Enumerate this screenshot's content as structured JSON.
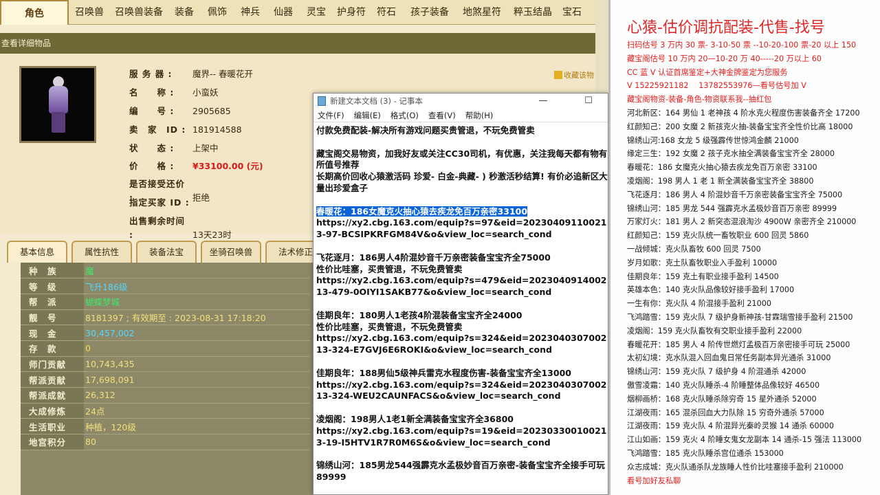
{
  "game": {
    "tabs": [
      "角色",
      "召唤兽",
      "召唤兽装备",
      "装备",
      "佩饰",
      "神兵",
      "仙器",
      "灵宝",
      "护身符",
      "符石",
      "孩子装备",
      "地煞星符",
      "粹玉结晶",
      "宝石"
    ],
    "window_title": "查看详细物品",
    "favorite_label": "收藏该物",
    "info": {
      "server_label": "服 务 器 :",
      "server_value": "魔界-- 春暖花开",
      "name_label": "名　　称 :",
      "name_value": "小蛮妖",
      "id_label": "编　　号 :",
      "id_value": "2905685",
      "seller_label": "卖　家　ID :",
      "seller_value": "181914588",
      "status_label": "状　　态 :",
      "status_value": "上架中",
      "price_label": "价　　格 :",
      "price_value": "¥33100.00 (元)",
      "bargain_label": "是否接受还价 :",
      "bargain_value": "拒绝",
      "buyer_label": "指定买家 ID :",
      "buyer_value": "",
      "remain_label": "出售剩余时间 :",
      "remain_value": "13天23时"
    },
    "subtabs": [
      "基本信息",
      "属性抗性",
      "装备法宝",
      "坐骑召唤兽",
      "法术修正"
    ],
    "stats": [
      {
        "k": "种　族",
        "v": "魔"
      },
      {
        "k": "等　级",
        "v": "飞升186级"
      },
      {
        "k": "帮　派",
        "v": "蝴蝶梦城"
      },
      {
        "k": "靓　号",
        "v": "8181397 ;  有效期至 :  2023-08-31 17:18:20"
      },
      {
        "k": "现　金",
        "v": "30,457,002"
      },
      {
        "k": "存　款",
        "v": "0"
      },
      {
        "k": "师门贡献",
        "v": "10,743,435"
      },
      {
        "k": "帮派贡献",
        "v": "17,698,091"
      },
      {
        "k": "帮派成就",
        "v": "26,312"
      },
      {
        "k": "大成修炼",
        "v": "24点"
      },
      {
        "k": "生活职业",
        "v": "种植，120级"
      },
      {
        "k": "地宫积分",
        "v": "80"
      }
    ]
  },
  "notepad": {
    "title": "新建文本文档 (3) - 记事本",
    "menu": [
      "文件(F)",
      "编辑(E)",
      "格式(O)",
      "查看(V)",
      "帮助(H)"
    ],
    "paragraphs": [
      "付款免费配装-解决所有游戏问题买贵管退，不玩免费管卖",
      "藏宝阁交易物资，加我好友或关注CC30司机，有优惠，关注我每天都有物有所值号推荐\n长期高价回收心猿激活码 珍爱- 白金-典藏- ) 秒激活秒结算! 有价必追新区大量出珍爱盒子",
      "__SEL__https://xy2.cbg.163.com/equip?s=97&eid=202304091100213-97-BCSIPKRFGM84V&o&view_loc=search_cond",
      "飞花逐月：186男人4阶混妙音千万亲密装备宝宝齐全75000\n性价比哇塞，买贵管退，不玩免费管卖\nhttps://xy2.cbg.163.com/equip?s=479&eid=202304091400213-479-0OIYI1SAKB77&o&view_loc=search_cond",
      "佳期良年：180男人1老孩4阶混装备宝宝齐全24000\n性价比哇塞，买贵管退，不玩免费管卖\nhttps://xy2.cbg.163.com/equip?s=324&eid=202304030700213-324-E7GVJ6E6ROKI&o&view_loc=search_cond",
      "佳期良年：188男仙5级神兵雷克水程度伤害-装备宝宝齐全13000\nhttps://xy2.cbg.163.com/equip?s=324&eid=202304030700213-324-WEU2CAUNFACS&o&view_loc=search_cond",
      "凌烟阁：198男人1老1新全满装备宝宝齐全36800\nhttps://xy2.cbg.163.com/equip?s=19&eid=202303300100213-19-I5HTV1R7R0M6S&o&view_loc=search_cond",
      "锦绣山河：185男龙544强霹克水孟极妙音百万亲密-装备宝宝齐全接手可玩89999"
    ],
    "selected": "春暖花：186女魔克火抽心猿去疾龙免百万亲密33100"
  },
  "promo": {
    "title": "心猿-估价调抗配装-代售-找号",
    "red_lines": [
      "扫码估号 3 万内 30 票- 3-10-50 票 --10-20-100 票-20 以上 150",
      "藏宝阁估号 10 万内 20—10-20 万 40-----20 万以上 60",
      "CC 蓝 V 认证首席鉴定+大神金牌鉴定为您服务",
      "V 15225921182　  13782553976—看号估号加 V",
      "藏宝阁物资-装备-角色-物资联系我--抽红包"
    ],
    "black_lines": [
      "河北新区：164 男仙 1 老神孩 4 阶水克火程度伤害装备齐全 17200",
      "红颜知己：200 女魔 2 新孩克火抽-装备宝宝齐全性价比高 18000",
      "锦绣山河:168 女龙 5 级强霹传世惊鸿金麟 21000",
      "缘定三生：192 女魔 2 孩子克水抽全满装备宝宝齐全 28000",
      "春暖花：186 女魔克火抽心猿去疾龙免百万亲密 33100",
      "凌烟阁：198 男人 1 老 1 新全满装备宝宝齐全 38800",
      "飞花逐月：186 男人 4 阶混妙音千万亲密装备宝宝齐全 75000",
      "锦绣山河：185 男龙 544 强霹克水孟极妙音百万亲密 89999",
      "万家灯火：181 男人 2 新突态混浪淘沙 4900W 亲密齐全 210000",
      "红颜知己：159 克火队统一畜牧职业 600 回灵 5860",
      "一战倾城：克火队畜牧 600 回灵 7500",
      "岁月如歌：克土队畜牧职业入手盈利 10000",
      "佳期良年：159 克土有职业接手盈利 14500",
      "英雄本色：140 克火队品像较好接手盈利 17000",
      "一生有你：克火队 4 阶混接手盈利 21000",
      "飞鸿踏雪：159 克火队 7 级护身新神孩-甘霖瑞雪接手盈利 21500",
      "凌烟阁：159 克火队畜牧有交职业接手盈利 22000",
      "春暖花开：185 男人 4 阶传世燃灯孟极百万亲密接手可玩 25000",
      "太初幻境：克水队混入回血鬼日常任务副本异光通杀 31000",
      "锦绣山河：159 克火队 7 级护身 4 阶混通杀 42000",
      "傲雪凌霜：140 克火队睡杀-4 阶睡整体品像较好 46500",
      "烟柳画桥：168 克火队睡杀除穷奇 15 星外通杀 52000",
      "江湖夜雨：165 混杀回血大力队除 15 穷奇外通杀 57000",
      "江湖夜雨：159 克火队 4 阶混异光秦岭灵猴 14 通杀 60000",
      "江山如画：159 克火 4 阶睡女鬼女龙副本 14 通杀-15 强法 113000",
      "飞鸿踏雪：185 克火队睡杀宫位通杀 153000",
      "众志成城：克火队通杀队龙族睡人性价比哇塞接手盈利 210000"
    ],
    "footer": "看号加好友私聊"
  }
}
